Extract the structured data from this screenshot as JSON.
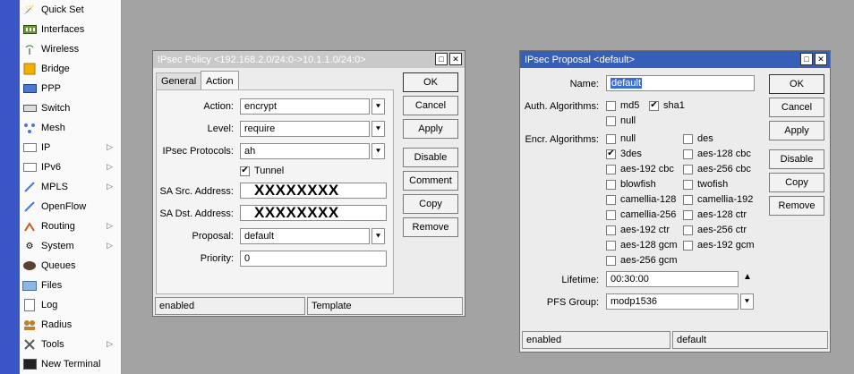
{
  "sidebar": {
    "items": [
      {
        "label": "Quick Set",
        "icon": "wand-icon",
        "arrow": false
      },
      {
        "label": "Interfaces",
        "icon": "interfaces-icon",
        "arrow": false
      },
      {
        "label": "Wireless",
        "icon": "wireless-icon",
        "arrow": false
      },
      {
        "label": "Bridge",
        "icon": "bridge-icon",
        "arrow": false
      },
      {
        "label": "PPP",
        "icon": "ppp-icon",
        "arrow": false
      },
      {
        "label": "Switch",
        "icon": "switch-icon",
        "arrow": false
      },
      {
        "label": "Mesh",
        "icon": "mesh-icon",
        "arrow": false
      },
      {
        "label": "IP",
        "icon": "ip-icon",
        "arrow": true
      },
      {
        "label": "IPv6",
        "icon": "ipv6-icon",
        "arrow": true
      },
      {
        "label": "MPLS",
        "icon": "mpls-icon",
        "arrow": true
      },
      {
        "label": "OpenFlow",
        "icon": "openflow-icon",
        "arrow": false
      },
      {
        "label": "Routing",
        "icon": "routing-icon",
        "arrow": true
      },
      {
        "label": "System",
        "icon": "system-gear-icon",
        "arrow": true
      },
      {
        "label": "Queues",
        "icon": "queues-icon",
        "arrow": false
      },
      {
        "label": "Files",
        "icon": "folder-icon",
        "arrow": false
      },
      {
        "label": "Log",
        "icon": "log-icon",
        "arrow": false
      },
      {
        "label": "Radius",
        "icon": "radius-users-icon",
        "arrow": false
      },
      {
        "label": "Tools",
        "icon": "tools-icon",
        "arrow": true
      },
      {
        "label": "New Terminal",
        "icon": "terminal-icon",
        "arrow": false
      }
    ]
  },
  "policy": {
    "title": "IPsec Policy <192.168.2.0/24:0->10.1.1.0/24:0>",
    "tabs": [
      "General",
      "Action"
    ],
    "labels": {
      "action": "Action:",
      "level": "Level:",
      "protocols": "IPsec Protocols:",
      "sa_src": "SA Src. Address:",
      "sa_dst": "SA Dst. Address:",
      "proposal": "Proposal:",
      "priority": "Priority:"
    },
    "values": {
      "action": "encrypt",
      "level": "require",
      "protocols": "ah",
      "sa_src": "XXXXXXXX",
      "sa_dst": "XXXXXXXX",
      "proposal": "default",
      "priority": "0"
    },
    "tunnel_label": "Tunnel",
    "buttons": [
      "OK",
      "Cancel",
      "Apply",
      "Disable",
      "Comment",
      "Copy",
      "Remove"
    ],
    "status": [
      "enabled",
      "Template"
    ]
  },
  "proposal": {
    "title": "IPsec Proposal <default>",
    "labels": {
      "name": "Name:",
      "auth": "Auth. Algorithms:",
      "encr": "Encr. Algorithms:",
      "lifetime": "Lifetime:",
      "pfs": "PFS Group:"
    },
    "values": {
      "name": "default",
      "lifetime": "00:30:00",
      "pfs": "modp1536"
    },
    "auth_algs": {
      "md5": "md5",
      "sha1": "sha1",
      "null": "null"
    },
    "encr_left": [
      "null",
      "3des",
      "aes-192 cbc",
      "blowfish",
      "camellia-128",
      "camellia-256",
      "aes-192 ctr",
      "aes-128 gcm",
      "aes-256 gcm"
    ],
    "encr_right": [
      "des",
      "aes-128 cbc",
      "aes-256 cbc",
      "twofish",
      "camellia-192",
      "aes-128 ctr",
      "aes-256 ctr",
      "aes-192 gcm"
    ],
    "buttons": [
      "OK",
      "Cancel",
      "Apply",
      "Disable",
      "Copy",
      "Remove"
    ],
    "status": [
      "enabled",
      "default"
    ]
  }
}
